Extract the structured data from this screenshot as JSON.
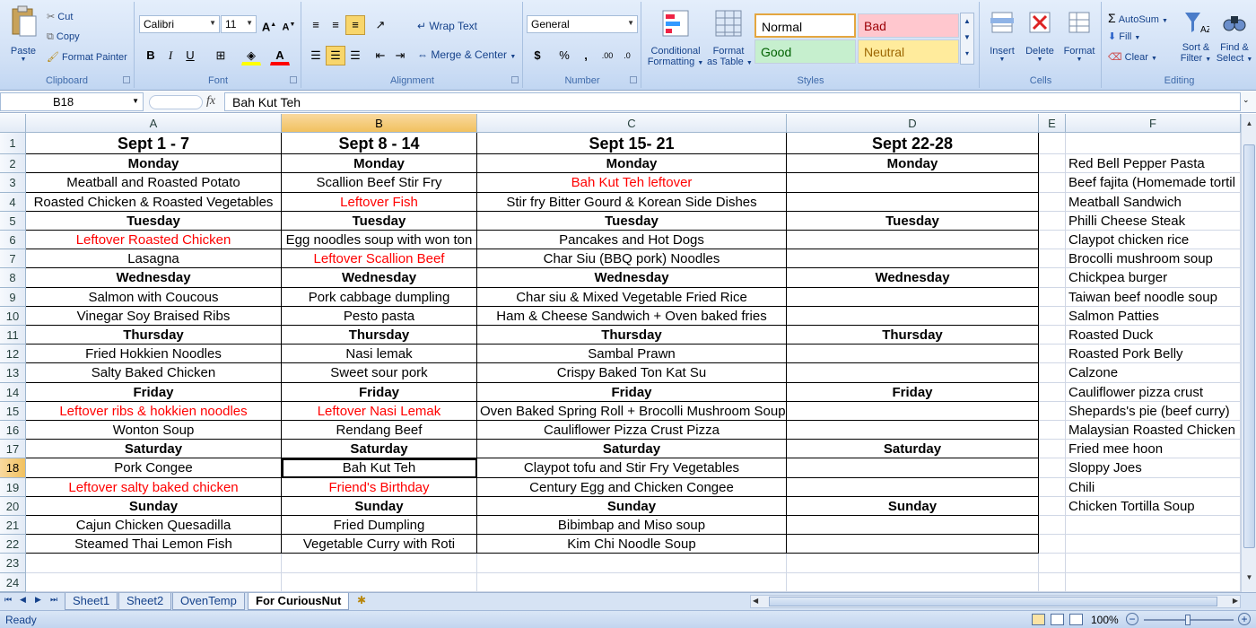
{
  "ribbon": {
    "clipboard": {
      "title": "Clipboard",
      "paste": "Paste",
      "cut": "Cut",
      "copy": "Copy",
      "format_painter": "Format Painter"
    },
    "font": {
      "title": "Font",
      "name": "Calibri",
      "size": "11",
      "bold": "B",
      "italic": "I",
      "underline": "U"
    },
    "alignment": {
      "title": "Alignment",
      "wrap_text": "Wrap Text",
      "merge_center": "Merge & Center"
    },
    "number": {
      "title": "Number",
      "format": "General",
      "currency": "$",
      "percent": "%",
      "comma": ","
    },
    "styles": {
      "title": "Styles",
      "conditional": "Conditional",
      "formatting": "Formatting",
      "format_as": "Format",
      "as_table": "as Table",
      "normal": "Normal",
      "bad": "Bad",
      "good": "Good",
      "neutral": "Neutral"
    },
    "cells": {
      "title": "Cells",
      "insert": "Insert",
      "delete": "Delete",
      "format": "Format"
    },
    "editing": {
      "title": "Editing",
      "autosum": "AutoSum",
      "fill": "Fill",
      "clear": "Clear",
      "sort_filter": "Sort &",
      "filter": "Filter",
      "find_select": "Find &",
      "select": "Select"
    }
  },
  "formula_bar": {
    "name_box": "B18",
    "fx": "fx",
    "value": "Bah Kut Teh"
  },
  "colors": {
    "accent": "#15428b",
    "red_text": "#ff0000",
    "selected_header": "#f1c15f",
    "bad_bg": "#ffc7ce",
    "good_bg": "#c6efce",
    "neutral_bg": "#ffeb9c"
  },
  "columns": [
    "A",
    "B",
    "C",
    "D",
    "E",
    "F"
  ],
  "selected_col": "B",
  "selected_row": 18,
  "rows": [
    {
      "n": 1,
      "hd": true,
      "cells": [
        "Sept 1 - 7",
        "Sept 8 - 14",
        "Sept 15- 21",
        "Sept 22-28",
        "",
        ""
      ]
    },
    {
      "n": 2,
      "b": true,
      "cells": [
        "Monday",
        "Monday",
        "Monday",
        "Monday",
        "",
        "Red Bell Pepper Pasta"
      ]
    },
    {
      "n": 3,
      "cells": [
        "Meatball and Roasted Potato",
        "Scallion Beef Stir Fry",
        "Bah Kut Teh leftover",
        "",
        "",
        "Beef fajita (Homemade tortil"
      ],
      "red": [
        2
      ]
    },
    {
      "n": 4,
      "cells": [
        "Roasted Chicken & Roasted Vegetables",
        "Leftover Fish",
        "Stir fry Bitter Gourd & Korean Side Dishes",
        "",
        "",
        "Meatball Sandwich"
      ],
      "red": [
        1
      ]
    },
    {
      "n": 5,
      "b": true,
      "cells": [
        "Tuesday",
        "Tuesday",
        "Tuesday",
        "Tuesday",
        "",
        "Philli Cheese Steak"
      ]
    },
    {
      "n": 6,
      "cells": [
        "Leftover Roasted Chicken",
        "Egg noodles soup with won ton",
        "Pancakes and Hot Dogs",
        "",
        "",
        "Claypot chicken rice"
      ],
      "red": [
        0
      ]
    },
    {
      "n": 7,
      "cells": [
        "Lasagna",
        "Leftover Scallion Beef",
        "Char Siu (BBQ pork) Noodles",
        "",
        "",
        "Brocolli mushroom soup"
      ],
      "red": [
        1
      ]
    },
    {
      "n": 8,
      "b": true,
      "cells": [
        "Wednesday",
        "Wednesday",
        "Wednesday",
        "Wednesday",
        "",
        "Chickpea burger"
      ]
    },
    {
      "n": 9,
      "cells": [
        "Salmon with Coucous",
        "Pork cabbage dumpling",
        "Char siu & Mixed Vegetable Fried Rice",
        "",
        "",
        "Taiwan beef noodle soup"
      ]
    },
    {
      "n": 10,
      "cells": [
        "Vinegar Soy Braised Ribs",
        "Pesto pasta",
        "Ham & Cheese Sandwich + Oven baked fries",
        "",
        "",
        "Salmon Patties"
      ]
    },
    {
      "n": 11,
      "b": true,
      "cells": [
        "Thursday",
        "Thursday",
        "Thursday",
        "Thursday",
        "",
        "Roasted Duck"
      ]
    },
    {
      "n": 12,
      "cells": [
        "Fried Hokkien Noodles",
        "Nasi lemak",
        "Sambal Prawn",
        "",
        "",
        "Roasted Pork Belly"
      ]
    },
    {
      "n": 13,
      "cells": [
        "Salty Baked Chicken",
        "Sweet sour pork",
        "Crispy Baked Ton Kat Su",
        "",
        "",
        "Calzone"
      ]
    },
    {
      "n": 14,
      "b": true,
      "cells": [
        "Friday",
        "Friday",
        "Friday",
        "Friday",
        "",
        "Cauliflower pizza crust"
      ]
    },
    {
      "n": 15,
      "cells": [
        "Leftover ribs & hokkien noodles",
        "Leftover Nasi Lemak",
        "Oven Baked Spring Roll + Brocolli Mushroom Soup",
        "",
        "",
        "Shepards's pie (beef curry)"
      ],
      "red": [
        0,
        1
      ]
    },
    {
      "n": 16,
      "cells": [
        "Wonton Soup",
        "Rendang Beef",
        "Cauliflower Pizza Crust Pizza",
        "",
        "",
        "Malaysian Roasted Chicken F"
      ]
    },
    {
      "n": 17,
      "b": true,
      "cells": [
        "Saturday",
        "Saturday",
        "Saturday",
        "Saturday",
        "",
        "Fried mee hoon"
      ]
    },
    {
      "n": 18,
      "cells": [
        "Pork Congee",
        "Bah Kut Teh",
        "Claypot tofu and Stir Fry Vegetables",
        "",
        "",
        "Sloppy Joes"
      ]
    },
    {
      "n": 19,
      "cells": [
        "Leftover salty baked chicken",
        "Friend's Birthday",
        "Century Egg and Chicken Congee",
        "",
        "",
        "Chili"
      ],
      "red": [
        0,
        1
      ]
    },
    {
      "n": 20,
      "b": true,
      "cells": [
        "Sunday",
        "Sunday",
        "Sunday",
        "Sunday",
        "",
        "Chicken Tortilla Soup"
      ]
    },
    {
      "n": 21,
      "cells": [
        "Cajun Chicken Quesadilla",
        "Fried Dumpling",
        "Bibimbap and Miso soup",
        "",
        "",
        ""
      ]
    },
    {
      "n": 22,
      "cells": [
        "Steamed Thai Lemon Fish",
        "Vegetable Curry with Roti",
        "Kim Chi Noodle Soup",
        "",
        "",
        ""
      ]
    },
    {
      "n": 23,
      "cells": [
        "",
        "",
        "",
        "",
        "",
        ""
      ]
    },
    {
      "n": 24,
      "cells": [
        "",
        "",
        "",
        "",
        "",
        ""
      ]
    }
  ],
  "sheets": [
    "Sheet1",
    "Sheet2",
    "OvenTemp",
    "For CuriousNut"
  ],
  "active_sheet": "For CuriousNut",
  "status": {
    "ready": "Ready",
    "zoom": "100%"
  }
}
